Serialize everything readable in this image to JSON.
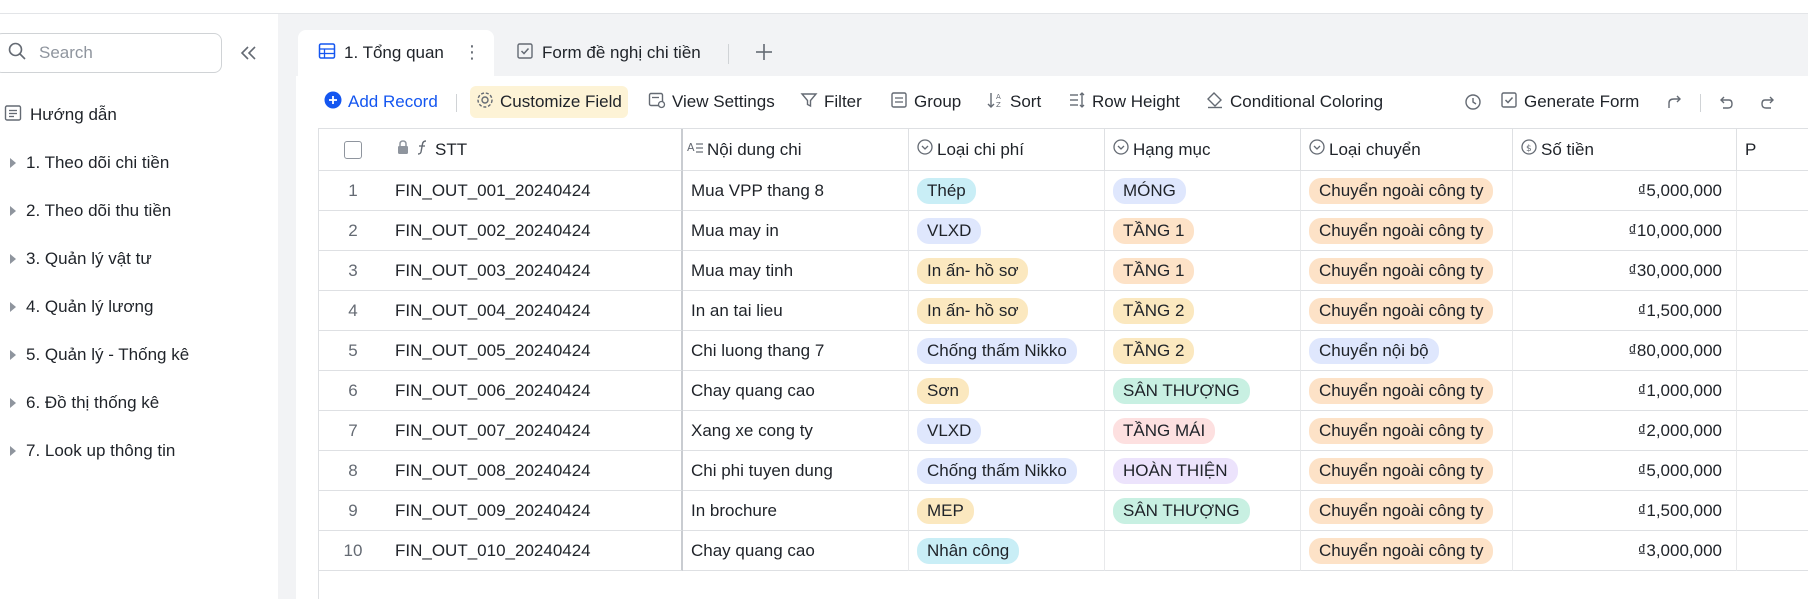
{
  "sidebar": {
    "search_placeholder": "Search",
    "guide": "Hướng dẫn",
    "items": [
      {
        "label": "1. Theo dõi chi tiền"
      },
      {
        "label": "2. Theo dõi thu tiền"
      },
      {
        "label": "3. Quản lý vật tư"
      },
      {
        "label": "4. Quản lý lương"
      },
      {
        "label": "5. Quản lý - Thống kê"
      },
      {
        "label": "6. Đồ thị thống kê"
      },
      {
        "label": "7. Look up thông tin"
      }
    ]
  },
  "tabs": [
    {
      "label": "1. Tổng quan",
      "icon": "grid-table-icon"
    },
    {
      "label": "Form đề nghị chi tiền",
      "icon": "form-check-icon"
    }
  ],
  "toolbar": {
    "add_record": "Add Record",
    "customize_field": "Customize Field",
    "view_settings": "View Settings",
    "filter": "Filter",
    "group": "Group",
    "sort": "Sort",
    "row_height": "Row Height",
    "conditional_coloring": "Conditional Coloring",
    "generate_form": "Generate Form"
  },
  "columns": {
    "stt": "STT",
    "noi_dung": "Nội dung chi",
    "loai_chi_phi": "Loại chi phí",
    "hang_muc": "Hạng mục",
    "loai_chuyen": "Loại chuyển",
    "so_tien": "Số tiền",
    "next": "P"
  },
  "rows": [
    {
      "n": "1",
      "stt": "FIN_OUT_001_20240424",
      "noi_dung": "Mua VPP thang 8",
      "loai_chi_phi": "Thép",
      "hang_muc": "MÓNG",
      "loai_chuyen": "Chuyển ngoài công ty",
      "so_tien": "₫5,000,000"
    },
    {
      "n": "2",
      "stt": "FIN_OUT_002_20240424",
      "noi_dung": "Mua may in",
      "loai_chi_phi": "VLXD",
      "hang_muc": "TẦNG 1",
      "loai_chuyen": "Chuyển ngoài công ty",
      "so_tien": "₫10,000,000"
    },
    {
      "n": "3",
      "stt": "FIN_OUT_003_20240424",
      "noi_dung": "Mua may tinh",
      "loai_chi_phi": "In ấn- hồ sơ",
      "hang_muc": "TẦNG 1",
      "loai_chuyen": "Chuyển ngoài công ty",
      "so_tien": "₫30,000,000"
    },
    {
      "n": "4",
      "stt": "FIN_OUT_004_20240424",
      "noi_dung": "In an tai lieu",
      "loai_chi_phi": "In ấn- hồ sơ",
      "hang_muc": "TẦNG 2",
      "loai_chuyen": "Chuyển ngoài công ty",
      "so_tien": "₫1,500,000"
    },
    {
      "n": "5",
      "stt": "FIN_OUT_005_20240424",
      "noi_dung": "Chi luong thang 7",
      "loai_chi_phi": "Chống thấm Nikko",
      "hang_muc": "TẦNG 2",
      "loai_chuyen": "Chuyển nội bộ",
      "so_tien": "₫80,000,000"
    },
    {
      "n": "6",
      "stt": "FIN_OUT_006_20240424",
      "noi_dung": "Chay quang cao",
      "loai_chi_phi": "Sơn",
      "hang_muc": "SÂN THƯỢNG",
      "loai_chuyen": "Chuyển ngoài công ty",
      "so_tien": "₫1,000,000"
    },
    {
      "n": "7",
      "stt": "FIN_OUT_007_20240424",
      "noi_dung": "Xang xe cong ty",
      "loai_chi_phi": "VLXD",
      "hang_muc": "TẦNG MÁI",
      "loai_chuyen": "Chuyển ngoài công ty",
      "so_tien": "₫2,000,000"
    },
    {
      "n": "8",
      "stt": "FIN_OUT_008_20240424",
      "noi_dung": "Chi phi tuyen dung",
      "loai_chi_phi": "Chống thấm Nikko",
      "hang_muc": "HOÀN THIỆN",
      "loai_chuyen": "Chuyển ngoài công ty",
      "so_tien": "₫5,000,000"
    },
    {
      "n": "9",
      "stt": "FIN_OUT_009_20240424",
      "noi_dung": "In brochure",
      "loai_chi_phi": "MEP",
      "hang_muc": "SÂN THƯỢNG",
      "loai_chuyen": "Chuyển ngoài công ty",
      "so_tien": "₫1,500,000"
    },
    {
      "n": "10",
      "stt": "FIN_OUT_010_20240424",
      "noi_dung": "Chay quang cao",
      "loai_chi_phi": "Nhân công",
      "hang_muc": "",
      "loai_chuyen": "Chuyển ngoài công ty",
      "so_tien": "₫3,000,000"
    }
  ],
  "colors": {
    "accent": "#1456f0",
    "Thép": "#c9eef6",
    "VLXD": "#dfe7fd",
    "In ấn- hồ sơ": "#fbe8bf",
    "Chống thấm Nikko": "#dfe7fd",
    "Sơn": "#fbe8bf",
    "MEP": "#fbe8bf",
    "Nhân công": "#c9eef6",
    "MÓNG": "#dfe7fd",
    "TẦNG 1": "#fde2c7",
    "TẦNG 2": "#fbe8bf",
    "SÂN THƯỢNG": "#c8f0e2",
    "TẦNG MÁI": "#fde0e0",
    "HOÀN THIỆN": "#ece3fc",
    "Chuyển ngoài công ty": "#fde2c7",
    "Chuyển nội bộ": "#dfe7fd"
  }
}
